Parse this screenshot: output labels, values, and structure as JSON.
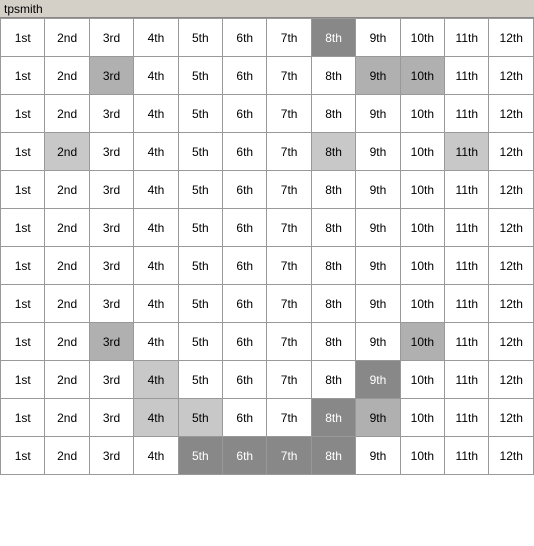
{
  "title": "tpsmith",
  "cols": [
    "1st",
    "2nd",
    "3rd",
    "4th",
    "5th",
    "6th",
    "7th",
    "8th",
    "9th",
    "10th",
    "11th",
    "12th"
  ],
  "rows": [
    [
      {
        "text": "1st",
        "style": ""
      },
      {
        "text": "2nd",
        "style": ""
      },
      {
        "text": "3rd",
        "style": ""
      },
      {
        "text": "4th",
        "style": ""
      },
      {
        "text": "5th",
        "style": ""
      },
      {
        "text": "6th",
        "style": ""
      },
      {
        "text": "7th",
        "style": ""
      },
      {
        "text": "8th",
        "style": "highlight-dark"
      },
      {
        "text": "9th",
        "style": ""
      },
      {
        "text": "10th",
        "style": ""
      },
      {
        "text": "11th",
        "style": ""
      },
      {
        "text": "12th",
        "style": ""
      }
    ],
    [
      {
        "text": "1st",
        "style": ""
      },
      {
        "text": "2nd",
        "style": ""
      },
      {
        "text": "3rd",
        "style": "highlight-gray"
      },
      {
        "text": "4th",
        "style": ""
      },
      {
        "text": "5th",
        "style": ""
      },
      {
        "text": "6th",
        "style": ""
      },
      {
        "text": "7th",
        "style": ""
      },
      {
        "text": "8th",
        "style": ""
      },
      {
        "text": "9th",
        "style": "highlight-gray"
      },
      {
        "text": "10th",
        "style": "highlight-gray"
      },
      {
        "text": "11th",
        "style": ""
      },
      {
        "text": "12th",
        "style": ""
      }
    ],
    [
      {
        "text": "1st",
        "style": ""
      },
      {
        "text": "2nd",
        "style": ""
      },
      {
        "text": "3rd",
        "style": ""
      },
      {
        "text": "4th",
        "style": ""
      },
      {
        "text": "5th",
        "style": ""
      },
      {
        "text": "6th",
        "style": ""
      },
      {
        "text": "7th",
        "style": ""
      },
      {
        "text": "8th",
        "style": ""
      },
      {
        "text": "9th",
        "style": ""
      },
      {
        "text": "10th",
        "style": ""
      },
      {
        "text": "11th",
        "style": ""
      },
      {
        "text": "12th",
        "style": ""
      }
    ],
    [
      {
        "text": "1st",
        "style": ""
      },
      {
        "text": "2nd",
        "style": "highlight-light"
      },
      {
        "text": "3rd",
        "style": ""
      },
      {
        "text": "4th",
        "style": ""
      },
      {
        "text": "5th",
        "style": ""
      },
      {
        "text": "6th",
        "style": ""
      },
      {
        "text": "7th",
        "style": ""
      },
      {
        "text": "8th",
        "style": "highlight-light"
      },
      {
        "text": "9th",
        "style": ""
      },
      {
        "text": "10th",
        "style": ""
      },
      {
        "text": "11th",
        "style": "highlight-light"
      },
      {
        "text": "12th",
        "style": ""
      }
    ],
    [
      {
        "text": "1st",
        "style": ""
      },
      {
        "text": "2nd",
        "style": ""
      },
      {
        "text": "3rd",
        "style": ""
      },
      {
        "text": "4th",
        "style": ""
      },
      {
        "text": "5th",
        "style": ""
      },
      {
        "text": "6th",
        "style": ""
      },
      {
        "text": "7th",
        "style": ""
      },
      {
        "text": "8th",
        "style": ""
      },
      {
        "text": "9th",
        "style": ""
      },
      {
        "text": "10th",
        "style": ""
      },
      {
        "text": "11th",
        "style": ""
      },
      {
        "text": "12th",
        "style": ""
      }
    ],
    [
      {
        "text": "1st",
        "style": ""
      },
      {
        "text": "2nd",
        "style": ""
      },
      {
        "text": "3rd",
        "style": ""
      },
      {
        "text": "4th",
        "style": ""
      },
      {
        "text": "5th",
        "style": ""
      },
      {
        "text": "6th",
        "style": ""
      },
      {
        "text": "7th",
        "style": ""
      },
      {
        "text": "8th",
        "style": ""
      },
      {
        "text": "9th",
        "style": ""
      },
      {
        "text": "10th",
        "style": ""
      },
      {
        "text": "11th",
        "style": ""
      },
      {
        "text": "12th",
        "style": ""
      }
    ],
    [
      {
        "text": "1st",
        "style": ""
      },
      {
        "text": "2nd",
        "style": ""
      },
      {
        "text": "3rd",
        "style": ""
      },
      {
        "text": "4th",
        "style": ""
      },
      {
        "text": "5th",
        "style": ""
      },
      {
        "text": "6th",
        "style": ""
      },
      {
        "text": "7th",
        "style": ""
      },
      {
        "text": "8th",
        "style": ""
      },
      {
        "text": "9th",
        "style": ""
      },
      {
        "text": "10th",
        "style": ""
      },
      {
        "text": "11th",
        "style": ""
      },
      {
        "text": "12th",
        "style": ""
      }
    ],
    [
      {
        "text": "1st",
        "style": ""
      },
      {
        "text": "2nd",
        "style": ""
      },
      {
        "text": "3rd",
        "style": ""
      },
      {
        "text": "4th",
        "style": ""
      },
      {
        "text": "5th",
        "style": ""
      },
      {
        "text": "6th",
        "style": ""
      },
      {
        "text": "7th",
        "style": ""
      },
      {
        "text": "8th",
        "style": ""
      },
      {
        "text": "9th",
        "style": ""
      },
      {
        "text": "10th",
        "style": ""
      },
      {
        "text": "11th",
        "style": ""
      },
      {
        "text": "12th",
        "style": ""
      }
    ],
    [
      {
        "text": "1st",
        "style": ""
      },
      {
        "text": "2nd",
        "style": ""
      },
      {
        "text": "3rd",
        "style": "highlight-gray"
      },
      {
        "text": "4th",
        "style": ""
      },
      {
        "text": "5th",
        "style": ""
      },
      {
        "text": "6th",
        "style": ""
      },
      {
        "text": "7th",
        "style": ""
      },
      {
        "text": "8th",
        "style": ""
      },
      {
        "text": "9th",
        "style": ""
      },
      {
        "text": "10th",
        "style": "highlight-gray"
      },
      {
        "text": "11th",
        "style": ""
      },
      {
        "text": "12th",
        "style": ""
      }
    ],
    [
      {
        "text": "1st",
        "style": ""
      },
      {
        "text": "2nd",
        "style": ""
      },
      {
        "text": "3rd",
        "style": ""
      },
      {
        "text": "4th",
        "style": "highlight-light"
      },
      {
        "text": "5th",
        "style": ""
      },
      {
        "text": "6th",
        "style": ""
      },
      {
        "text": "7th",
        "style": ""
      },
      {
        "text": "8th",
        "style": ""
      },
      {
        "text": "9th",
        "style": "highlight-dark"
      },
      {
        "text": "10th",
        "style": ""
      },
      {
        "text": "11th",
        "style": ""
      },
      {
        "text": "12th",
        "style": ""
      }
    ],
    [
      {
        "text": "1st",
        "style": ""
      },
      {
        "text": "2nd",
        "style": ""
      },
      {
        "text": "3rd",
        "style": ""
      },
      {
        "text": "4th",
        "style": "highlight-light"
      },
      {
        "text": "5th",
        "style": "highlight-light"
      },
      {
        "text": "6th",
        "style": ""
      },
      {
        "text": "7th",
        "style": ""
      },
      {
        "text": "8th",
        "style": "highlight-dark"
      },
      {
        "text": "9th",
        "style": "highlight-gray"
      },
      {
        "text": "10th",
        "style": ""
      },
      {
        "text": "11th",
        "style": ""
      },
      {
        "text": "12th",
        "style": ""
      }
    ],
    [
      {
        "text": "1st",
        "style": ""
      },
      {
        "text": "2nd",
        "style": ""
      },
      {
        "text": "3rd",
        "style": ""
      },
      {
        "text": "4th",
        "style": ""
      },
      {
        "text": "5th",
        "style": "highlight-dark"
      },
      {
        "text": "6th",
        "style": "highlight-dark"
      },
      {
        "text": "7th",
        "style": "highlight-dark"
      },
      {
        "text": "8th",
        "style": "highlight-dark"
      },
      {
        "text": "9th",
        "style": ""
      },
      {
        "text": "10th",
        "style": ""
      },
      {
        "text": "11th",
        "style": ""
      },
      {
        "text": "12th",
        "style": ""
      }
    ]
  ]
}
